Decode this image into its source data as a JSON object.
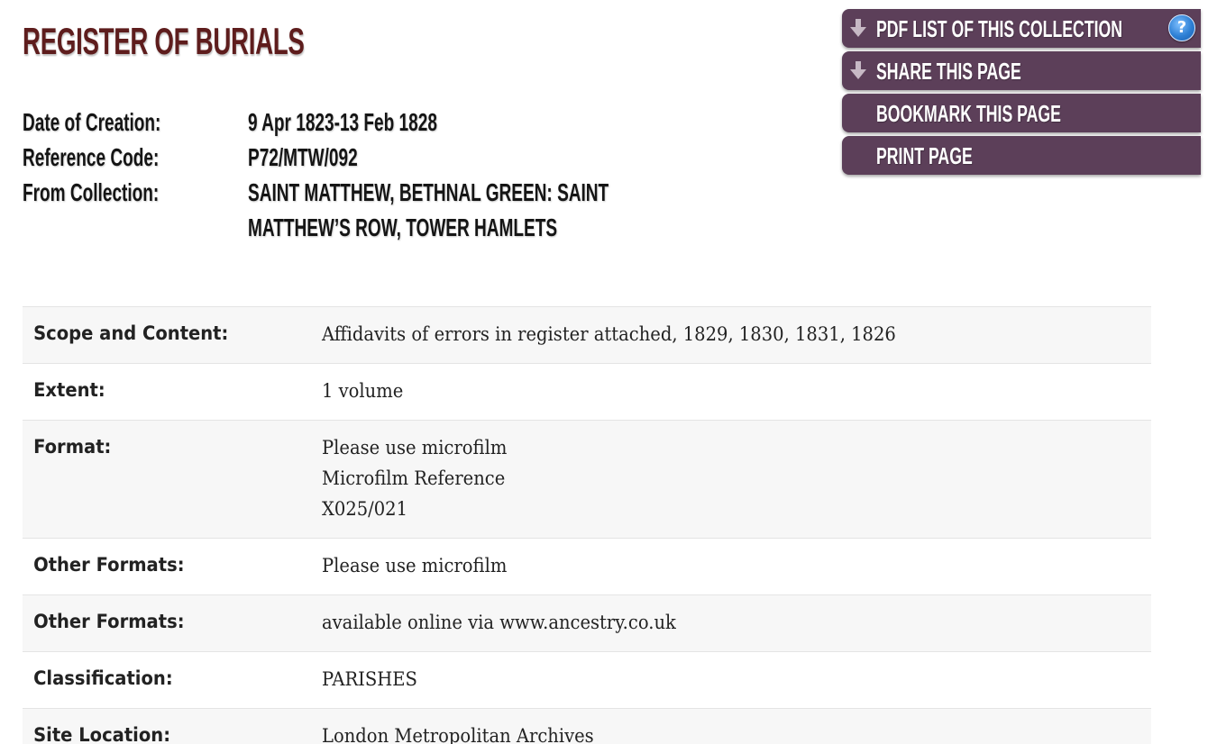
{
  "page": {
    "title": "REGISTER OF BURIALS"
  },
  "summary": [
    {
      "label": "Date of Creation:",
      "value": "9 Apr 1823-13 Feb 1828"
    },
    {
      "label": "Reference Code:",
      "value": "P72/MTW/092"
    },
    {
      "label": "From Collection:",
      "value": "SAINT MATTHEW, BETHNAL GREEN: SAINT MATTHEW’S ROW, TOWER HAMLETS"
    }
  ],
  "actions": {
    "items": [
      {
        "label": "PDF LIST OF THIS COLLECTION",
        "icon": "download-arrow-icon"
      },
      {
        "label": "SHARE THIS PAGE",
        "icon": "download-arrow-icon"
      },
      {
        "label": "BOOKMARK THIS PAGE",
        "icon": ""
      },
      {
        "label": "PRINT PAGE",
        "icon": ""
      }
    ],
    "help_glyph": "?",
    "button_color": "#5c3f59"
  },
  "details": [
    {
      "label": "Scope and Content:",
      "lines": [
        "Affidavits of errors in register attached, 1829, 1830, 1831, 1826"
      ]
    },
    {
      "label": "Extent:",
      "lines": [
        "1 volume"
      ]
    },
    {
      "label": "Format:",
      "lines": [
        "Please use microfilm",
        "Microfilm Reference",
        "X025/021"
      ]
    },
    {
      "label": "Other Formats:",
      "lines": [
        "Please use microfilm"
      ]
    },
    {
      "label": "Other Formats:",
      "lines": [
        "available online via www.ancestry.co.uk"
      ]
    },
    {
      "label": "Classification:",
      "lines": [
        "PARISHES"
      ]
    },
    {
      "label": "Site Location:",
      "lines": [
        "London Metropolitan Archives"
      ]
    }
  ],
  "colors": {
    "title": "#5e1d1d",
    "row_alt": "#f7f7f7",
    "help_icon": "#2d7fd4"
  }
}
